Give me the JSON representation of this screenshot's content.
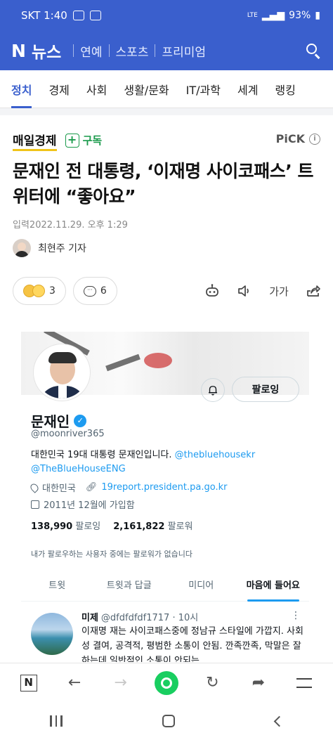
{
  "status_bar": {
    "carrier_time": "SKT 1:40",
    "network": "LTE",
    "battery": "93%"
  },
  "header": {
    "logo_n": "N",
    "logo_text": "뉴스",
    "nav": [
      "연예",
      "스포츠",
      "프리미엄"
    ],
    "search_icon": "search-icon",
    "colors": {
      "brand": "#3a5fcd"
    }
  },
  "tabs": [
    {
      "label": "정치",
      "active": true
    },
    {
      "label": "경제"
    },
    {
      "label": "사회"
    },
    {
      "label": "생활/문화"
    },
    {
      "label": "IT/과학"
    },
    {
      "label": "세계"
    },
    {
      "label": "랭킹"
    }
  ],
  "article": {
    "press": "매일경제",
    "subscribe_label": "구독",
    "pick_label": "PiCK",
    "headline": "문재인 전 대통령, ‘이재명 사이코패스’ 트위터에 “좋아요”",
    "date": "입력2022.11.29. 오후 1:29",
    "reporter": "최현주 기자",
    "reaction_count": "3",
    "comment_count": "6",
    "font_size_label": "가가"
  },
  "twitter": {
    "name": "문재인",
    "handle": "@moonriver365",
    "follow_label": "팔로잉",
    "bio_text": "대한민국 19대 대통령 문재인입니다.",
    "bio_link1": "@thebluehousekr",
    "bio_link2": "@TheBlueHouseENG",
    "location": "대한민국",
    "website": "19report.president.pa.go.kr",
    "joined": "2011년 12월에 가입함",
    "following_count": "138,990",
    "following_label": "팔로잉",
    "followers_count": "2,161,822",
    "followers_label": "팔로워",
    "note": "내가 팔로우하는 사용자 중에는 팔로워가 없습니다",
    "tabs": [
      "트윗",
      "트윗과 답글",
      "미디어",
      "마음에 들어요"
    ],
    "active_tab_index": 3,
    "tweet": {
      "author": "미제",
      "meta": "@dfdfdfdf1717 · 10시",
      "body": "이재명 재는 사이코패스중에 정남규 스타일에 가깝지. 사회성 결여, 공격적, 평범한 소통이 안됨. 깐족깐족, 막말은 잘하는데 일반적인 소통이 안되는"
    }
  },
  "browser_bar": {
    "n_label": "N"
  }
}
